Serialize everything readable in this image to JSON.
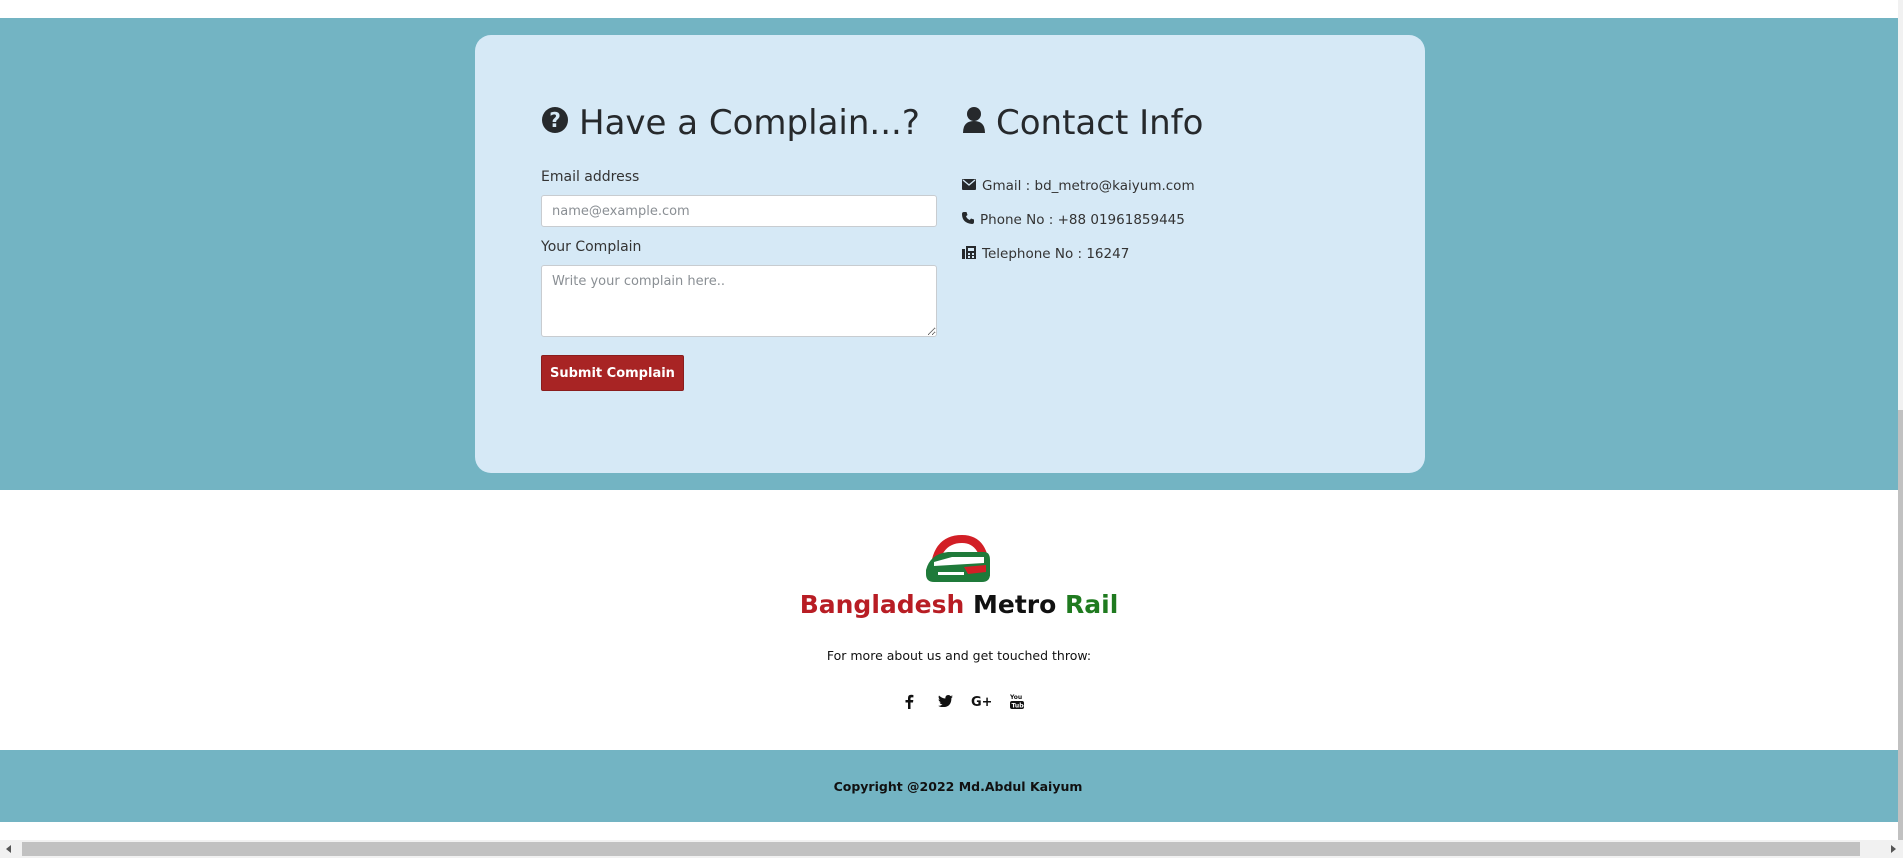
{
  "complaint": {
    "heading": "Have a Complain...?",
    "email_label": "Email address",
    "email_placeholder": "name@example.com",
    "complain_label": "Your Complain",
    "complain_placeholder": "Write your complain here..",
    "submit_label": "Submit Complain"
  },
  "contact": {
    "heading": "Contact Info",
    "items": [
      {
        "icon": "envelope-icon",
        "text": "Gmail : bd_metro@kaiyum.com"
      },
      {
        "icon": "phone-icon",
        "text": "Phone No : +88 01961859445"
      },
      {
        "icon": "fax-icon",
        "text": "Telephone No : 16247"
      }
    ]
  },
  "footer": {
    "brand": {
      "part1": "Bangladesh",
      "part2": "Metro",
      "part3": "Rail"
    },
    "tagline": "For more about us and get touched throw:",
    "social": [
      "facebook-icon",
      "twitter-icon",
      "google-plus-icon",
      "youtube-icon"
    ],
    "copyright": "Copyright @2022 Md.Abdul Kaiyum"
  },
  "colors": {
    "band": "#73b4c3",
    "card": "#d6e9f6",
    "button": "#a82424",
    "brand_red": "#b81d24",
    "brand_green": "#1f7a1f"
  }
}
